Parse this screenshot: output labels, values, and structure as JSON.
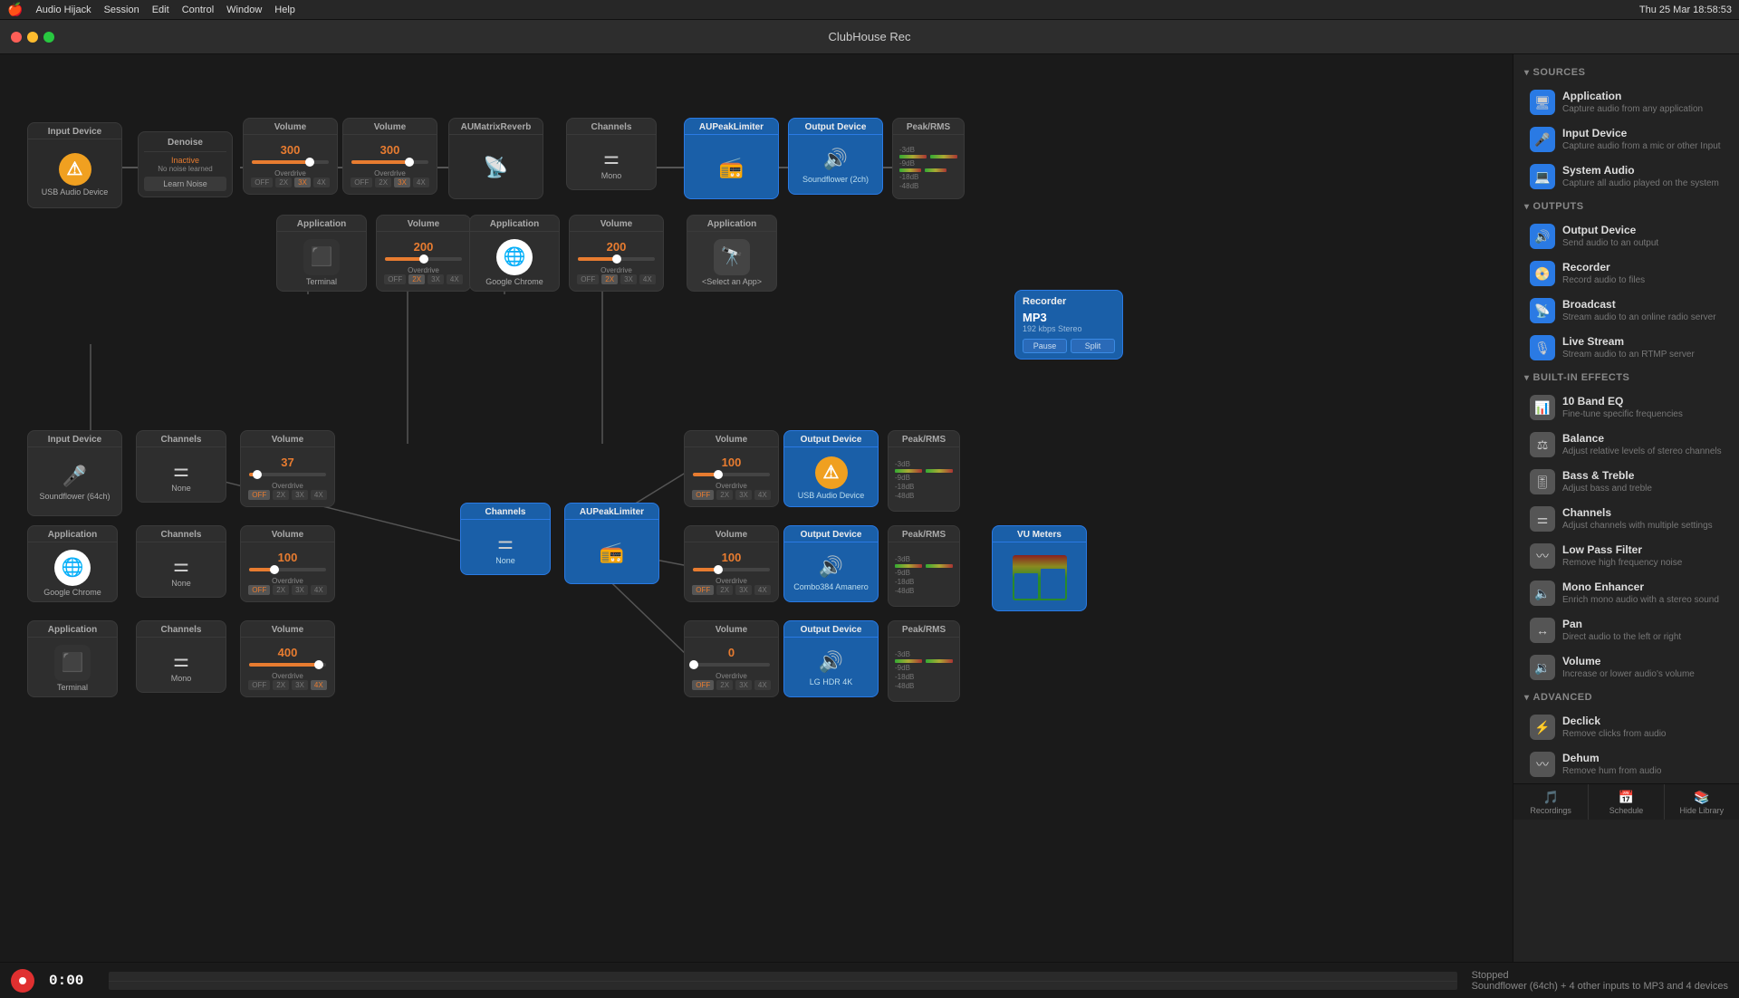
{
  "app": {
    "title": "ClubHouse Rec",
    "menuItems": [
      "Audio Hijack",
      "Session",
      "Edit",
      "Control",
      "Window",
      "Help"
    ],
    "time": "Thu 25 Mar  18:58:53"
  },
  "sidebar": {
    "sources_header": "SOURCES",
    "outputs_header": "OUTPUTS",
    "builtin_header": "BUILT-IN EFFECTS",
    "advanced_header": "ADVANCED",
    "sources": [
      {
        "name": "Application",
        "desc": "Capture audio from any application"
      },
      {
        "name": "Input Device",
        "desc": "Capture audio from a mic or other Input"
      },
      {
        "name": "System Audio",
        "desc": "Capture all audio played on the system"
      }
    ],
    "outputs": [
      {
        "name": "Output Device",
        "desc": "Send audio to an output"
      },
      {
        "name": "Recorder",
        "desc": "Record audio to files"
      },
      {
        "name": "Broadcast",
        "desc": "Stream audio to an online radio server"
      },
      {
        "name": "Live Stream",
        "desc": "Stream audio to an RTMP server"
      }
    ],
    "builtin": [
      {
        "name": "10 Band EQ",
        "desc": "Fine-tune specific frequencies"
      },
      {
        "name": "Balance",
        "desc": "Adjust relative levels of stereo channels"
      },
      {
        "name": "Bass & Treble",
        "desc": "Adjust bass and treble"
      },
      {
        "name": "Channels",
        "desc": "Adjust channels with multiple settings"
      },
      {
        "name": "Low Pass Filter",
        "desc": "Remove high frequency noise"
      },
      {
        "name": "Mono Enhancer",
        "desc": "Enrich mono audio with a stereo sound"
      },
      {
        "name": "Pan",
        "desc": "Direct audio to the left or right"
      },
      {
        "name": "Volume",
        "desc": "Increase or lower audio's volume"
      }
    ],
    "advanced": [
      {
        "name": "Declick",
        "desc": "Remove clicks from audio"
      },
      {
        "name": "Dehum",
        "desc": "Remove hum from audio"
      }
    ],
    "bottom_btns": [
      "Recordings",
      "Schedule",
      "Hide Library"
    ]
  },
  "nodes": {
    "input_device_top": {
      "title": "Input Device",
      "label": "USB Audio Device"
    },
    "denoise": {
      "title": "Denoise",
      "status": "Inactive",
      "sub": "No noise learned",
      "btn": "Learn Noise"
    },
    "volume1": {
      "title": "Volume",
      "value": "300",
      "fill": 75,
      "overdrive": "Overdrive",
      "btns": [
        "OFF",
        "2X",
        "3X",
        "4X"
      ],
      "active": 2
    },
    "volume2": {
      "title": "Volume",
      "value": "300",
      "fill": 75,
      "overdrive": "Overdrive",
      "btns": [
        "OFF",
        "2X",
        "3X",
        "4X"
      ],
      "active": 2
    },
    "aumatrix": {
      "title": "AUMatrixReverb"
    },
    "channels_top": {
      "title": "Channels",
      "label": "Mono"
    },
    "au_peak_top": {
      "title": "AUPeakLimiter"
    },
    "output_device_top": {
      "title": "Output Device",
      "label": "Soundflower (2ch)"
    },
    "peak_rms_top": {
      "title": "Peak/RMS",
      "vals": [
        "-3dB",
        "-9dB",
        "-18dB",
        "-48dB"
      ]
    },
    "app_terminal1": {
      "title": "Application",
      "label": "Terminal"
    },
    "volume3": {
      "title": "Volume",
      "value": "200",
      "fill": 50,
      "overdrive": "Overdrive",
      "btns": [
        "OFF",
        "2X",
        "3X",
        "4X"
      ],
      "active": 1
    },
    "app_chrome1": {
      "title": "Application",
      "label": "Google Chrome"
    },
    "volume4": {
      "title": "Volume",
      "value": "200",
      "fill": 50,
      "overdrive": "Overdrive",
      "btns": [
        "OFF",
        "2X",
        "3X",
        "4X"
      ],
      "active": 1
    },
    "app_select": {
      "title": "Application",
      "label": "<Select an App>"
    },
    "recorder": {
      "title": "Recorder",
      "format": "MP3",
      "details": "192 kbps Stereo",
      "btn1": "Pause",
      "btn2": "Split"
    },
    "input_soundflower": {
      "title": "Input Device",
      "label": "Soundflower (64ch)"
    },
    "channels_none1": {
      "title": "Channels",
      "label": "None"
    },
    "volume5": {
      "title": "Volume",
      "value": "37",
      "fill": 10,
      "overdrive": "Overdrive",
      "btns": [
        "OFF",
        "2X",
        "3X",
        "4X"
      ],
      "active": 0
    },
    "volume6": {
      "title": "Volume",
      "value": "100",
      "fill": 33,
      "overdrive": "Overdrive",
      "btns": [
        "OFF",
        "2X",
        "3X",
        "4X"
      ],
      "active": 0
    },
    "output_usb": {
      "title": "Output Device",
      "label": "USB Audio Device"
    },
    "peak_rms2": {
      "title": "Peak/RMS",
      "vals": [
        "-3dB",
        "-9dB",
        "-18dB",
        "-48dB"
      ]
    },
    "channels_mid": {
      "title": "Channels",
      "label": "None"
    },
    "au_peak_mid": {
      "title": "AUPeakLimiter"
    },
    "app_chrome2": {
      "title": "Application",
      "label": "Google Chrome"
    },
    "channels_none2": {
      "title": "Channels",
      "label": "None"
    },
    "volume7": {
      "title": "Volume",
      "value": "100",
      "fill": 33,
      "overdrive": "Overdrive",
      "btns": [
        "OFF",
        "2X",
        "3X",
        "4X"
      ],
      "active": 0
    },
    "volume8": {
      "title": "Volume",
      "value": "100",
      "fill": 33,
      "overdrive": "Overdrive",
      "btns": [
        "OFF",
        "2X",
        "3X",
        "4X"
      ],
      "active": 0
    },
    "output_combo": {
      "title": "Output Device",
      "label": "Combo384 Amanero"
    },
    "peak_rms3": {
      "title": "Peak/RMS",
      "vals": [
        "-3dB",
        "-9dB",
        "-18dB",
        "-48dB"
      ]
    },
    "vu_meters": {
      "title": "VU Meters"
    },
    "app_terminal2": {
      "title": "Application",
      "label": "Terminal"
    },
    "channels_mono": {
      "title": "Channels",
      "label": "Mono"
    },
    "volume9": {
      "title": "Volume",
      "value": "400",
      "fill": 90,
      "overdrive": "Overdrive",
      "btns": [
        "OFF",
        "2X",
        "3X",
        "4X"
      ],
      "active": 3
    },
    "volume10": {
      "title": "Volume",
      "value": "0",
      "fill": 1,
      "overdrive": "Overdrive",
      "btns": [
        "OFF",
        "2X",
        "3X",
        "4X"
      ],
      "active": 0
    },
    "output_lg": {
      "title": "Output Device",
      "label": "LG HDR 4K"
    },
    "peak_rms4": {
      "title": "Peak/RMS",
      "vals": [
        "-3dB",
        "-9dB",
        "-18dB",
        "-48dB"
      ]
    }
  },
  "bottombar": {
    "time": "0:00",
    "status": "Stopped",
    "desc": "Soundflower (64ch) + 4 other inputs to MP3 and 4 devices"
  }
}
